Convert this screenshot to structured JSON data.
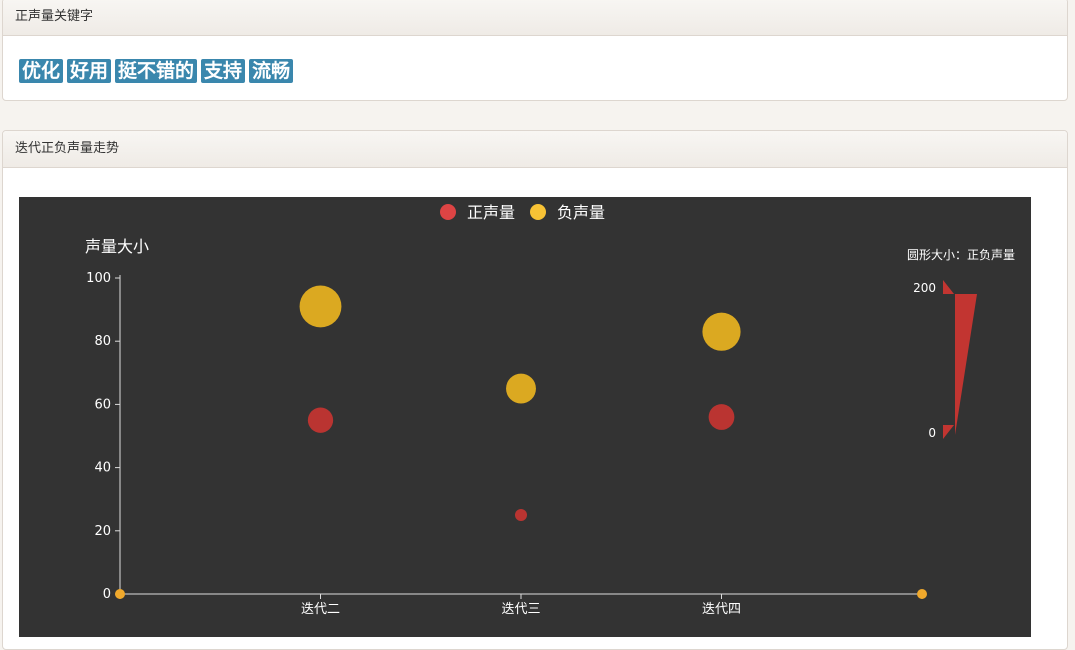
{
  "keywords_panel": {
    "title": "正声量关键字",
    "tags": [
      "优化",
      "好用",
      "挺不错的",
      "支持",
      "流畅"
    ]
  },
  "trend_panel": {
    "title": "迭代正负声量走势"
  },
  "colors": {
    "positive": "#c23531",
    "negative": "#e5b021",
    "legend_positive": "#dd4444",
    "legend_negative": "#f7c235",
    "tag_bg": "#3a87ad",
    "chart_bg": "#333333"
  },
  "chart_data": {
    "type": "scatter",
    "legend": [
      "正声量",
      "负声量"
    ],
    "ylabel": "声量大小",
    "ylim": [
      0,
      100
    ],
    "yticks": [
      0,
      20,
      40,
      60,
      80,
      100
    ],
    "categories": [
      "",
      "迭代二",
      "迭代三",
      "迭代四",
      ""
    ],
    "series": [
      {
        "name": "正声量",
        "points": [
          [
            1,
            55
          ],
          [
            2,
            25
          ],
          [
            3,
            56
          ]
        ]
      },
      {
        "name": "负声量",
        "points": [
          [
            1,
            91
          ],
          [
            2,
            65
          ],
          [
            3,
            83
          ]
        ]
      }
    ],
    "endpoint_values": [
      0,
      0
    ],
    "visual_map": {
      "title": "圆形大小：正负声量",
      "max": "200",
      "min": "0"
    }
  }
}
